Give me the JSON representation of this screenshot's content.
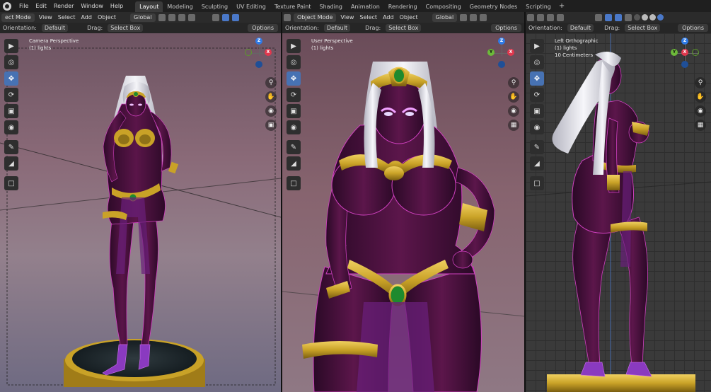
{
  "topbar": {
    "menus": [
      "File",
      "Edit",
      "Render",
      "Window",
      "Help"
    ],
    "workspaces": [
      "Layout",
      "Modeling",
      "Sculpting",
      "UV Editing",
      "Texture Paint",
      "Shading",
      "Animation",
      "Rendering",
      "Compositing",
      "Geometry Nodes",
      "Scripting"
    ],
    "active_workspace": "Layout",
    "add_tab": "+"
  },
  "viewports": [
    {
      "mode": "ect Mode",
      "menus": [
        "View",
        "Select",
        "Add",
        "Object"
      ],
      "transform": "Global",
      "orientation_label": "Orientation:",
      "orientation_value": "Default",
      "drag_label": "Drag:",
      "drag_value": "Select Box",
      "options": "Options",
      "title": "Camera Perspective",
      "collection": "(1) lights",
      "extra": ""
    },
    {
      "mode": "Object Mode",
      "menus": [
        "View",
        "Select",
        "Add",
        "Object"
      ],
      "transform": "Global",
      "orientation_label": "Orientation:",
      "orientation_value": "Default",
      "drag_label": "Drag:",
      "drag_value": "Select Box",
      "options": "Options",
      "title": "User Perspective",
      "collection": "(1) lights",
      "extra": ""
    },
    {
      "mode": "",
      "menus": [],
      "transform": "",
      "orientation_label": "Orientation:",
      "orientation_value": "Default",
      "drag_label": "Drag:",
      "drag_value": "Select Box",
      "options": "Options",
      "title": "Left Orthographic",
      "collection": "(1) lights",
      "extra": "10 Centimeters"
    }
  ],
  "gizmo_labels": {
    "z": "Z",
    "x": "X",
    "y": "Y"
  },
  "colors": {
    "accent": "#4772b3",
    "skin": "#4a0f3c",
    "gold": "#c9a227",
    "hair": "#e8e8ee",
    "gem": "#1e8a2e",
    "skirt": "#6a1f7a"
  },
  "icons": {
    "tools": [
      "select-box-icon",
      "cursor-icon",
      "move-icon",
      "rotate-icon",
      "scale-icon",
      "transform-icon",
      "annotate-icon",
      "measure-icon",
      "add-cube-icon"
    ],
    "nav": [
      "zoom-icon",
      "pan-hand-icon",
      "camera-icon",
      "lock-icon"
    ]
  }
}
